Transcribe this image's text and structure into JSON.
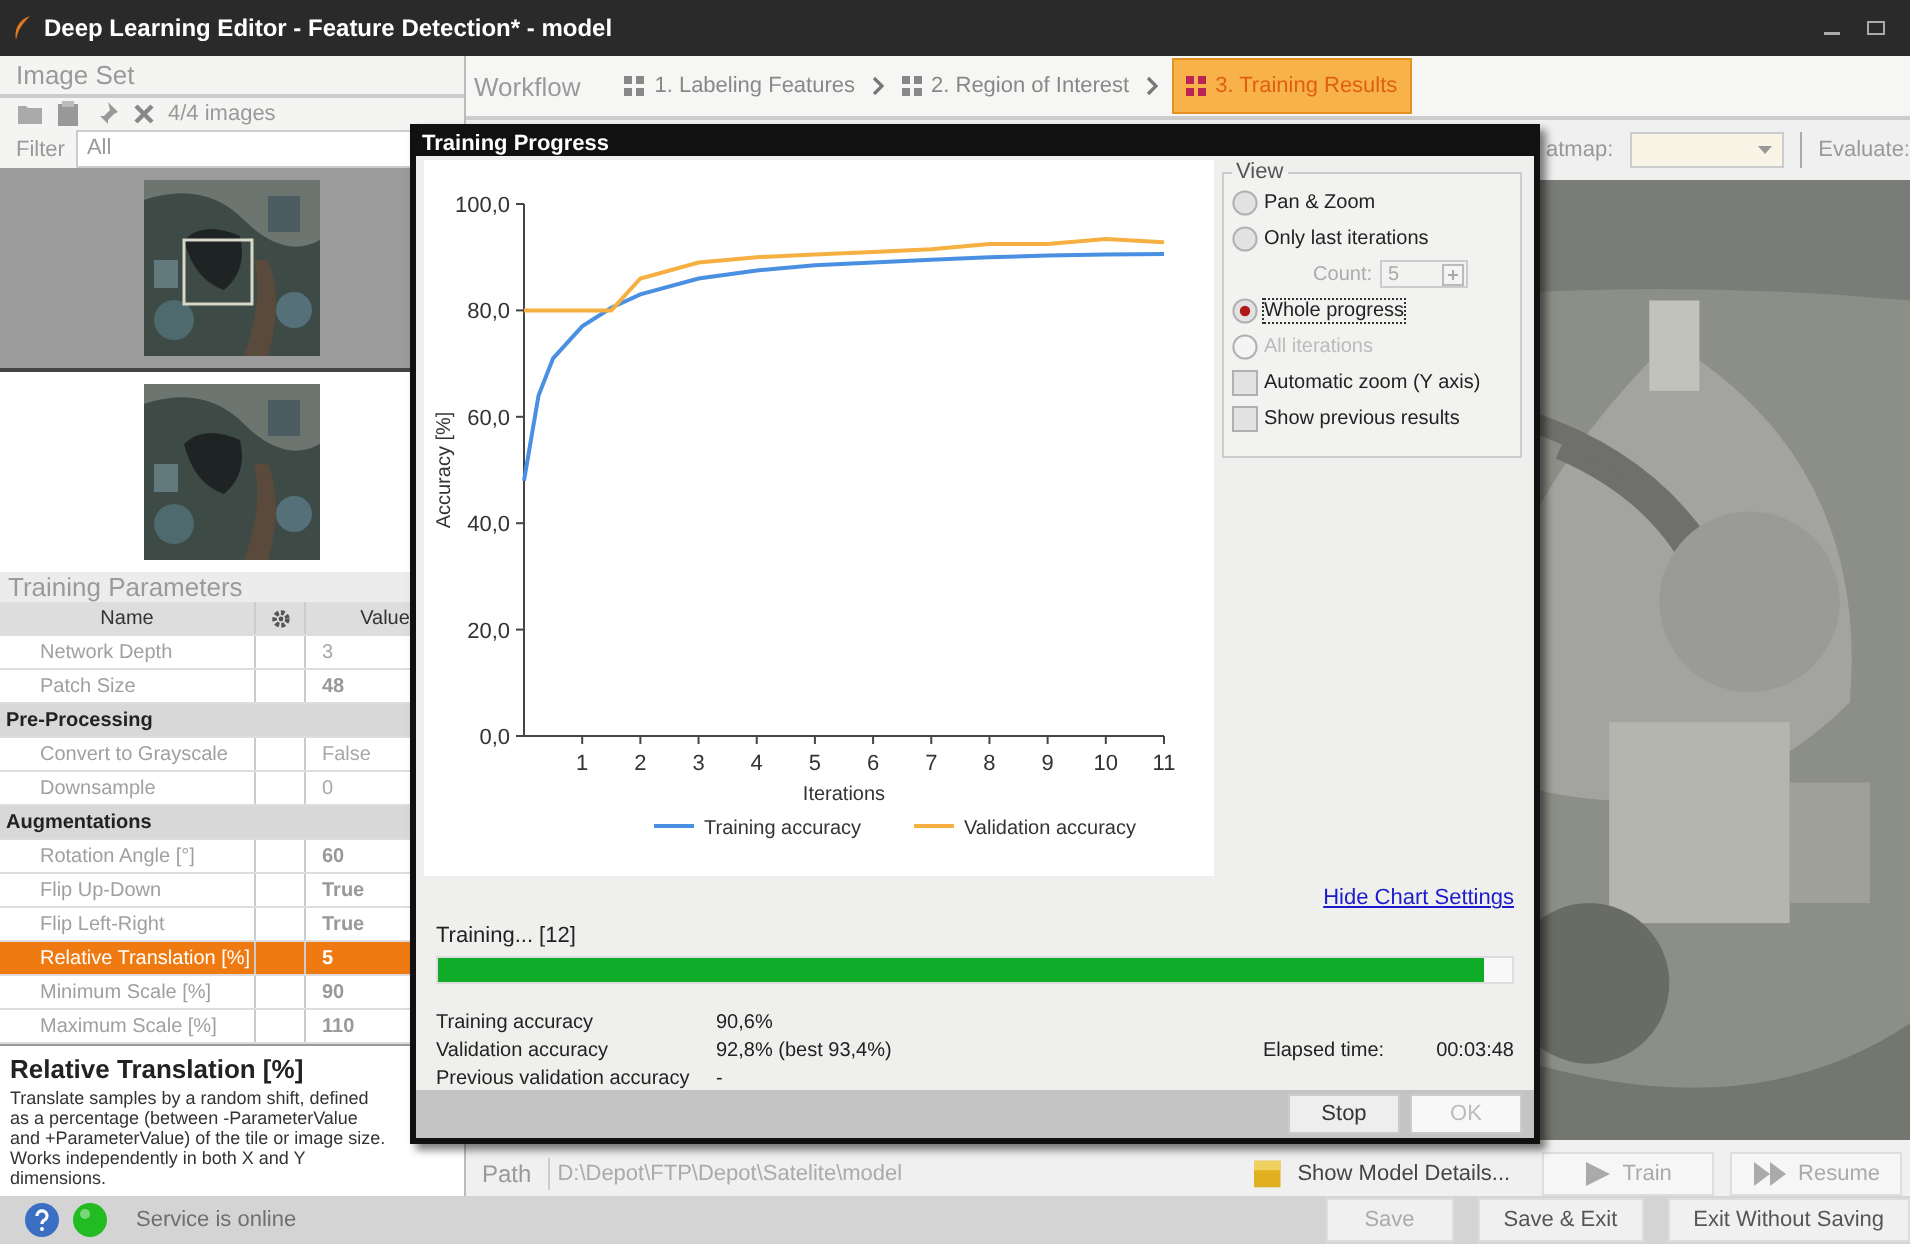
{
  "window": {
    "title": "Deep Learning Editor - Feature Detection* - model"
  },
  "image_set": {
    "title": "Image Set",
    "count": "4/4 images",
    "filter_label": "Filter",
    "filter_value": "All",
    "images": [
      {
        "kind": "picture",
        "selected": true
      },
      {
        "kind": "picture",
        "selected": false
      }
    ]
  },
  "workflow": {
    "label": "Workflow",
    "steps": [
      {
        "label": "1. Labeling Features",
        "selected": false
      },
      {
        "label": "2. Region of Interest",
        "selected": false
      },
      {
        "label": "3. Training Results",
        "selected": true
      }
    ]
  },
  "parameters": {
    "title": "Training Parameters",
    "columns": [
      "Name",
      "Value"
    ],
    "rows": [
      {
        "kind": "param",
        "name": "Network Depth",
        "value": "3",
        "modified": false,
        "selected": false
      },
      {
        "kind": "param",
        "name": "Patch Size",
        "value": "48",
        "modified": true,
        "selected": false
      },
      {
        "kind": "group",
        "name": "Pre-Processing"
      },
      {
        "kind": "param",
        "name": "Convert to Grayscale",
        "value": "False",
        "modified": false,
        "selected": false
      },
      {
        "kind": "param",
        "name": "Downsample",
        "value": "0",
        "modified": false,
        "selected": false
      },
      {
        "kind": "group",
        "name": "Augmentations"
      },
      {
        "kind": "param",
        "name": "Rotation Angle [°]",
        "value": "60",
        "modified": true,
        "selected": false
      },
      {
        "kind": "param",
        "name": "Flip Up-Down",
        "value": "True",
        "modified": true,
        "selected": false
      },
      {
        "kind": "param",
        "name": "Flip Left-Right",
        "value": "True",
        "modified": true,
        "selected": false
      },
      {
        "kind": "param",
        "name": "Relative Translation [%]",
        "value": "5",
        "modified": true,
        "selected": true
      },
      {
        "kind": "param",
        "name": "Minimum Scale [%]",
        "value": "90",
        "modified": true,
        "selected": false
      },
      {
        "kind": "param",
        "name": "Maximum Scale [%]",
        "value": "110",
        "modified": true,
        "selected": false
      }
    ]
  },
  "help": {
    "title": "Relative Translation [%]",
    "text": "Translate samples by a random shift, defined as a percentage (between -ParameterValue and +ParameterValue) of the tile or image size. Works independently in both X and Y dimensions."
  },
  "view_toolbar": {
    "heatmap_label": "atmap:",
    "evaluate_label": "Evaluate:"
  },
  "bottom_row": {
    "path_label": "Path",
    "path_value": "D:\\Depot\\FTP\\Depot\\Satelite\\model",
    "details_link": "Show Model Details...",
    "buttons": [
      {
        "label": "Train",
        "kind": "play",
        "disabled": true
      },
      {
        "label": "Resume",
        "kind": "resume",
        "disabled": true
      }
    ]
  },
  "status_bar": {
    "status": "Service is online",
    "online": true,
    "buttons": [
      {
        "label": "Save",
        "disabled": true
      },
      {
        "label": "Save & Exit",
        "disabled": false
      },
      {
        "label": "Exit Without Saving",
        "disabled": false
      }
    ]
  },
  "dialog": {
    "title": "Training Progress",
    "chart_data": {
      "type": "line",
      "xlabel": "Iterations",
      "ylabel": "Accuracy [%]",
      "x": [
        0,
        0.25,
        0.5,
        1,
        1.5,
        2,
        3,
        4,
        5,
        6,
        7,
        8,
        9,
        10,
        11
      ],
      "xlim": [
        0,
        11
      ],
      "ylim": [
        0,
        100
      ],
      "legend": "below",
      "xticks": [
        1,
        2,
        3,
        4,
        5,
        6,
        7,
        8,
        9,
        10,
        11
      ],
      "yticks": [
        {
          "value": 0,
          "label": "0,0"
        },
        {
          "value": 20,
          "label": "20,0"
        },
        {
          "value": 40,
          "label": "40,0"
        },
        {
          "value": 60,
          "label": "60,0"
        },
        {
          "value": 80,
          "label": "80,0"
        },
        {
          "value": 100,
          "label": "100,0"
        }
      ],
      "series": [
        {
          "name": "Training accuracy",
          "color": "#4a90e2",
          "values": [
            48,
            64,
            71,
            77,
            80.5,
            83,
            86,
            87.5,
            88.5,
            89,
            89.5,
            90,
            90.3,
            90.5,
            90.6
          ]
        },
        {
          "name": "Validation accuracy",
          "color": "#f5b041",
          "values": [
            80,
            80,
            80,
            80,
            80,
            86,
            89,
            90,
            90.5,
            91,
            91.5,
            92.5,
            92.5,
            93.4,
            92.8
          ]
        }
      ]
    },
    "view": {
      "title": "View",
      "options": [
        {
          "kind": "radio",
          "label": "Pan & Zoom",
          "selected": false,
          "disabled": false
        },
        {
          "kind": "radio",
          "label": "Only last iterations",
          "selected": false,
          "disabled": false
        },
        {
          "kind": "count",
          "label": "Count:",
          "value": "5",
          "disabled": true
        },
        {
          "kind": "radio",
          "label": "Whole progress",
          "selected": true,
          "disabled": false
        },
        {
          "kind": "radio",
          "label": "All iterations",
          "selected": false,
          "disabled": true
        },
        {
          "kind": "checkbox",
          "label": "Automatic zoom (Y axis)",
          "checked": false
        },
        {
          "kind": "checkbox",
          "label": "Show previous results",
          "checked": false
        }
      ]
    },
    "hide_link": "Hide Chart Settings",
    "progress_label": "Training... [12]",
    "progress": {
      "level": 0.974
    },
    "stats": [
      {
        "label": "Training accuracy",
        "value": "90,6%"
      },
      {
        "label": "Validation accuracy",
        "value": "92,8% (best 93,4%)"
      },
      {
        "label": "Previous validation accuracy",
        "value": "-"
      }
    ],
    "elapsed_label": "Elapsed time:",
    "elapsed_value": "00:03:48",
    "buttons": [
      {
        "label": "Stop",
        "disabled": false
      },
      {
        "label": "OK",
        "disabled": true
      }
    ]
  }
}
